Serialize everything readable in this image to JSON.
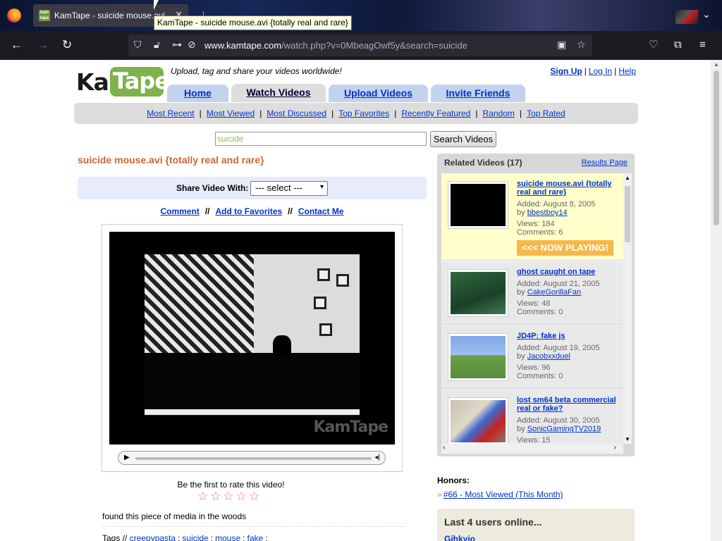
{
  "browser": {
    "tab_title": "KamTape - suicide mouse.avi",
    "tab_tooltip": "KamTape - suicide mouse.avi {totally real and rare}",
    "url_domain": "www.kamtape.com",
    "url_path": "/watch.php?v=0MbeagOwf5y&search=suicide"
  },
  "header": {
    "logo_kam": "Kam",
    "logo_tape": "Tape",
    "tagline": "Upload, tag and share your videos worldwide!",
    "user_links": [
      "Sign Up",
      "Log In",
      "Help"
    ]
  },
  "main_tabs": [
    "Home",
    "Watch Videos",
    "Upload Videos",
    "Invite Friends"
  ],
  "subnav": [
    "Most Recent",
    "Most Viewed",
    "Most Discussed",
    "Top Favorites",
    "Recently Featured",
    "Random",
    "Top Rated"
  ],
  "search": {
    "value": "suicide",
    "button": "Search Videos"
  },
  "video": {
    "title": "suicide mouse.avi {totally real and rare}",
    "share_label": "Share Video With:",
    "share_option": "--- select ---",
    "actions": [
      "Comment",
      "Add to Favorites",
      "Contact Me"
    ],
    "watermark": "KamTape",
    "rate_text": "Be the first to rate this video!",
    "stars": "☆☆☆☆☆",
    "description": "found this piece of media in the woods",
    "tags_label": "Tags //",
    "tags": [
      "creepypasta",
      "suicide",
      "mouse",
      "fake"
    ]
  },
  "related": {
    "title": "Related Videos (17)",
    "results_link": "Results Page",
    "now_playing": "<<< NOW PLAYING!",
    "items": [
      {
        "title": "suicide mouse.avi {totally real and rare}",
        "added": "Added: August 8, 2005",
        "by_label": "by",
        "user": "bbestboy14",
        "views": "Views: 184",
        "comments": "Comments: 6"
      },
      {
        "title": "ghost caught on tape",
        "added": "Added: August 21, 2005",
        "by_label": "by",
        "user": "CakeGorillaFan",
        "views": "Views: 48",
        "comments": "Comments: 0"
      },
      {
        "title": "JD4P: fake js",
        "added": "Added: August 19, 2005",
        "by_label": "by",
        "user": "Jacobxxduel",
        "views": "Views: 96",
        "comments": "Comments: 0"
      },
      {
        "title": "lost sm64 beta commercial real or fake?",
        "added": "Added: August 30, 2005",
        "by_label": "by",
        "user": "SonicGamingTV2019",
        "views": "Views: 15",
        "comments": ""
      }
    ]
  },
  "honors": {
    "label": "Honors:",
    "item": "#66 - Most Viewed (This Month)"
  },
  "users_online": {
    "title": "Last 4 users online...",
    "first_user": "Gihkyio"
  }
}
